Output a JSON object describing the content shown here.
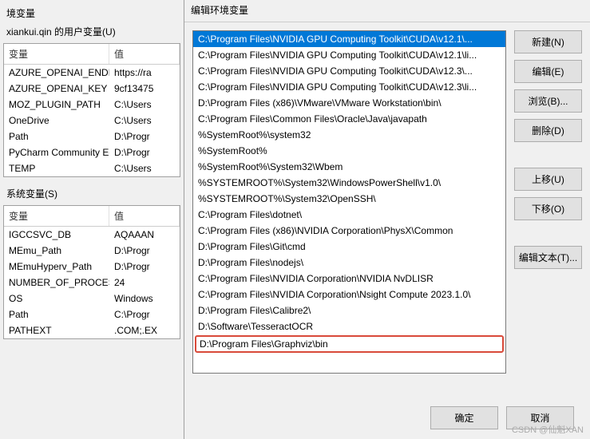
{
  "left": {
    "title_fragment": "境变量",
    "user_section_label": "xiankui.qin 的用户变量(U)",
    "sys_section_label": "系统变量(S)",
    "head_var": "变量",
    "head_val": "值",
    "user_vars": [
      {
        "name": "AZURE_OPENAI_ENDPOINT",
        "value": "https://ra"
      },
      {
        "name": "AZURE_OPENAI_KEY",
        "value": "9cf13475"
      },
      {
        "name": "MOZ_PLUGIN_PATH",
        "value": "C:\\Users"
      },
      {
        "name": "OneDrive",
        "value": "C:\\Users"
      },
      {
        "name": "Path",
        "value": "D:\\Progr"
      },
      {
        "name": "PyCharm Community Editi...",
        "value": "D:\\Progr"
      },
      {
        "name": "TEMP",
        "value": "C:\\Users"
      }
    ],
    "sys_vars": [
      {
        "name": "IGCCSVC_DB",
        "value": "AQAAAN"
      },
      {
        "name": "MEmu_Path",
        "value": "D:\\Progr"
      },
      {
        "name": "MEmuHyperv_Path",
        "value": "D:\\Progr"
      },
      {
        "name": "NUMBER_OF_PROCESSORS",
        "value": "24"
      },
      {
        "name": "OS",
        "value": "Windows"
      },
      {
        "name": "Path",
        "value": "C:\\Progr"
      },
      {
        "name": "PATHEXT",
        "value": ".COM;.EX"
      }
    ]
  },
  "dialog": {
    "title_fragment": "编辑环境变量",
    "items": [
      "C:\\Program Files\\NVIDIA GPU Computing Toolkit\\CUDA\\v12.1\\...",
      "C:\\Program Files\\NVIDIA GPU Computing Toolkit\\CUDA\\v12.1\\li...",
      "C:\\Program Files\\NVIDIA GPU Computing Toolkit\\CUDA\\v12.3\\...",
      "C:\\Program Files\\NVIDIA GPU Computing Toolkit\\CUDA\\v12.3\\li...",
      "D:\\Program Files (x86)\\VMware\\VMware Workstation\\bin\\",
      "C:\\Program Files\\Common Files\\Oracle\\Java\\javapath",
      "%SystemRoot%\\system32",
      "%SystemRoot%",
      "%SystemRoot%\\System32\\Wbem",
      "%SYSTEMROOT%\\System32\\WindowsPowerShell\\v1.0\\",
      "%SYSTEMROOT%\\System32\\OpenSSH\\",
      "C:\\Program Files\\dotnet\\",
      "C:\\Program Files (x86)\\NVIDIA Corporation\\PhysX\\Common",
      "D:\\Program Files\\Git\\cmd",
      "D:\\Program Files\\nodejs\\",
      "C:\\Program Files\\NVIDIA Corporation\\NVIDIA NvDLISR",
      "C:\\Program Files\\NVIDIA Corporation\\Nsight Compute 2023.1.0\\",
      "D:\\Program Files\\Calibre2\\",
      "D:\\Software\\TesseractOCR",
      "D:\\Program Files\\Graphviz\\bin"
    ],
    "selected_index": 0,
    "highlight_index": 19,
    "buttons": {
      "new": "新建(N)",
      "edit": "编辑(E)",
      "browse": "浏览(B)...",
      "delete": "删除(D)",
      "moveup": "上移(U)",
      "movedown": "下移(O)",
      "edittext": "编辑文本(T)...",
      "ok": "确定",
      "cancel": "取消"
    }
  },
  "watermark": "CSDN @仙魁XAN"
}
